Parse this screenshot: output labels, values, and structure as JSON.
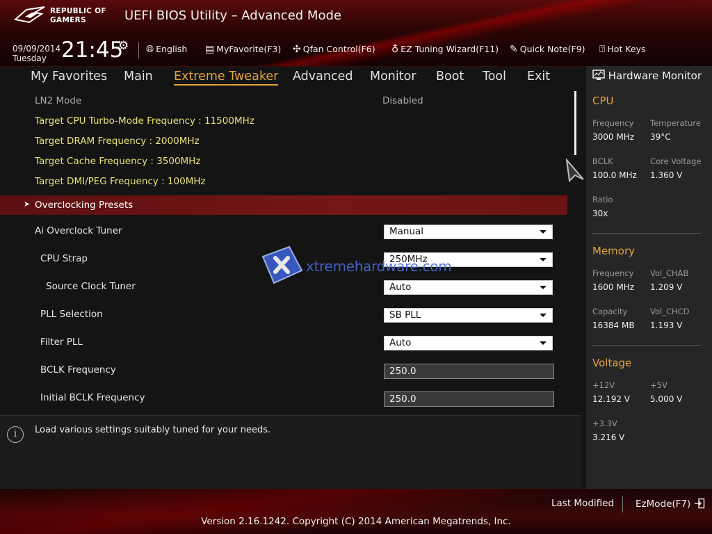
{
  "header": {
    "logo_line1": "REPUBLIC OF",
    "logo_line2": "GAMERS",
    "title": "UEFI BIOS Utility – Advanced Mode",
    "date": "09/09/2014",
    "day": "Tuesday",
    "time": "21:45",
    "toolbar": {
      "language": "English",
      "favorite": "MyFavorite(F3)",
      "qfan": "Qfan Control(F6)",
      "ez_tuning": "EZ Tuning Wizard(F11)",
      "quick_note": "Quick Note(F9)",
      "hot_keys": "Hot Keys"
    }
  },
  "tabs": [
    {
      "label": "My Favorites"
    },
    {
      "label": "Main"
    },
    {
      "label": "Extreme Tweaker",
      "active": true
    },
    {
      "label": "Advanced"
    },
    {
      "label": "Monitor"
    },
    {
      "label": "Boot"
    },
    {
      "label": "Tool"
    },
    {
      "label": "Exit"
    }
  ],
  "main": {
    "ln2_mode": {
      "label": "LN2 Mode",
      "value": "Disabled"
    },
    "targets": [
      "Target CPU Turbo-Mode Frequency : 11500MHz",
      "Target DRAM Frequency : 2000MHz",
      "Target Cache Frequency : 3500MHz",
      "Target DMI/PEG Frequency : 100MHz"
    ],
    "presets_label": "Overclocking Presets",
    "settings": [
      {
        "label": "Ai Overclock Tuner",
        "value": "Manual"
      },
      {
        "label": "CPU Strap",
        "value": "250MHz"
      },
      {
        "label": "Source Clock Tuner",
        "value": "Auto"
      },
      {
        "label": "PLL Selection",
        "value": "SB PLL"
      },
      {
        "label": "Filter PLL",
        "value": "Auto"
      },
      {
        "label": "BCLK Frequency",
        "value": "250.0"
      },
      {
        "label": "Initial BCLK Frequency",
        "value": "250.0"
      }
    ],
    "watermark_text": "xtremehardware.com"
  },
  "help_text": "Load various settings suitably tuned for your needs.",
  "hardware_monitor": {
    "title": "Hardware Monitor",
    "cpu": {
      "heading": "CPU",
      "frequency_label": "Frequency",
      "frequency": "3000 MHz",
      "temperature_label": "Temperature",
      "temperature": "39°C",
      "bclk_label": "BCLK",
      "bclk": "100.0 MHz",
      "core_voltage_label": "Core Voltage",
      "core_voltage": "1.360 V",
      "ratio_label": "Ratio",
      "ratio": "30x"
    },
    "memory": {
      "heading": "Memory",
      "frequency_label": "Frequency",
      "frequency": "1600 MHz",
      "vol_chab_label": "Vol_CHAB",
      "vol_chab": "1.209 V",
      "capacity_label": "Capacity",
      "capacity": "16384 MB",
      "vol_chcd_label": "Vol_CHCD",
      "vol_chcd": "1.193 V"
    },
    "voltage": {
      "heading": "Voltage",
      "v12_label": "+12V",
      "v12": "12.192 V",
      "v5_label": "+5V",
      "v5": "5.000 V",
      "v33_label": "+3.3V",
      "v33": "3.216 V"
    }
  },
  "footer": {
    "last_modified": "Last Modified",
    "ezmode": "EzMode(F7)",
    "version": "Version 2.16.1242. Copyright (C) 2014 American Megatrends, Inc."
  },
  "colors": {
    "accent": "#e6a23c",
    "target_text": "#e9e27a",
    "presets_bar": "#761616",
    "header_red": "#5a0a0a"
  }
}
